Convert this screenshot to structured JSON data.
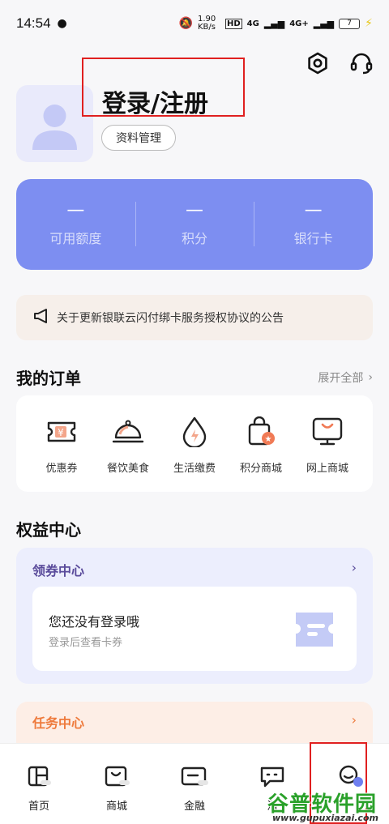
{
  "status_bar": {
    "time": "14:54",
    "net_speed": "1.90 KB/s",
    "hd_label": "HD",
    "signal_1": "4G",
    "signal_2": "4G+",
    "battery": "7"
  },
  "header": {
    "title": "登录/注册",
    "profile_button": "资料管理",
    "icons": [
      "settings-icon",
      "customer-service-icon"
    ]
  },
  "stats": [
    {
      "value": "—",
      "label": "可用额度"
    },
    {
      "value": "—",
      "label": "积分"
    },
    {
      "value": "—",
      "label": "银行卡"
    }
  ],
  "notice": {
    "text": "关于更新银联云闪付绑卡服务授权协议的公告"
  },
  "orders": {
    "title": "我的订单",
    "expand_label": "展开全部",
    "items": [
      {
        "label": "优惠券",
        "icon": "coupon-icon"
      },
      {
        "label": "餐饮美食",
        "icon": "dining-icon"
      },
      {
        "label": "生活缴费",
        "icon": "utility-icon"
      },
      {
        "label": "积分商城",
        "icon": "points-mall-icon"
      },
      {
        "label": "网上商城",
        "icon": "online-mall-icon"
      }
    ]
  },
  "benefits": {
    "title": "权益中心",
    "coupon_center": {
      "title": "领券中心",
      "empty_title": "您还没有登录哦",
      "empty_sub": "登录后查看卡券"
    },
    "task_center": {
      "title": "任务中心"
    }
  },
  "bottom_nav": [
    {
      "label": "首页",
      "icon": "home-icon"
    },
    {
      "label": "商城",
      "icon": "shop-icon"
    },
    {
      "label": "金融",
      "icon": "finance-icon"
    },
    {
      "label": "消",
      "icon": "message-icon"
    },
    {
      "label": "",
      "icon": "profile-icon"
    }
  ],
  "watermark": {
    "brand": "谷普软件园",
    "url": "www.gupuxiazai.com"
  },
  "colors": {
    "accent": "#7d8ef1",
    "highlight_box": "#e02020",
    "benefit_purple": "#5a4b9b",
    "task_orange": "#ee7a3c"
  }
}
